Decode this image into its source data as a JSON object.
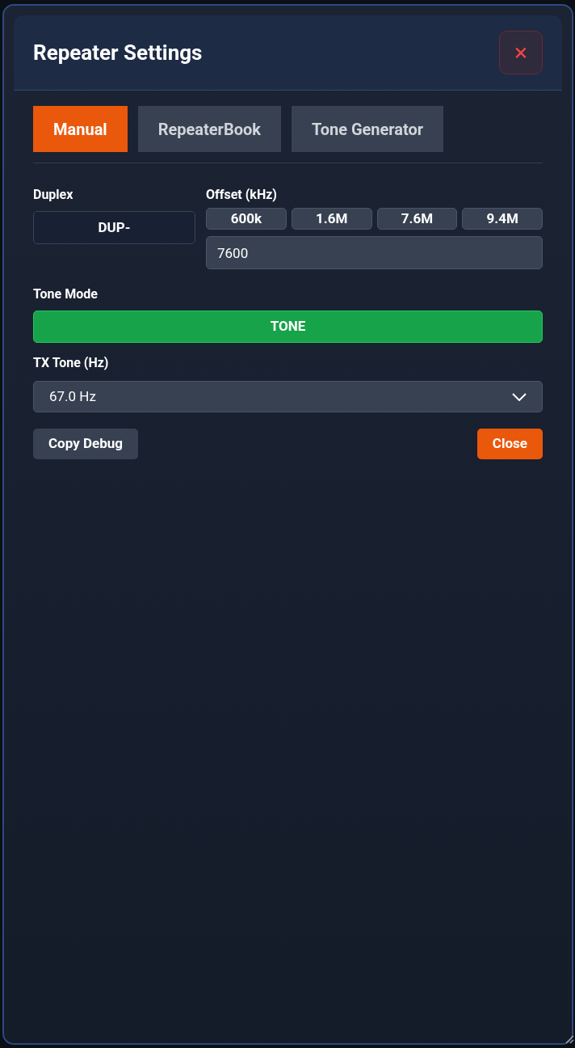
{
  "dialog": {
    "title": "Repeater Settings",
    "close_icon": "×"
  },
  "tabs": [
    {
      "label": "Manual",
      "selected": true
    },
    {
      "label": "RepeaterBook",
      "selected": false
    },
    {
      "label": "Tone Generator",
      "selected": false
    }
  ],
  "duplex": {
    "label": "Duplex",
    "value": "DUP-"
  },
  "offset": {
    "label": "Offset (kHz)",
    "presets": [
      "600k",
      "1.6M",
      "7.6M",
      "9.4M"
    ],
    "value": "7600"
  },
  "tone_mode": {
    "label": "Tone Mode",
    "value": "TONE"
  },
  "tx_tone": {
    "label": "TX Tone (Hz)",
    "value": "67.0 Hz"
  },
  "buttons": [
    {
      "label": "Copy Debug",
      "kind": "secondary"
    },
    {
      "label": "Close",
      "kind": "primary"
    }
  ]
}
